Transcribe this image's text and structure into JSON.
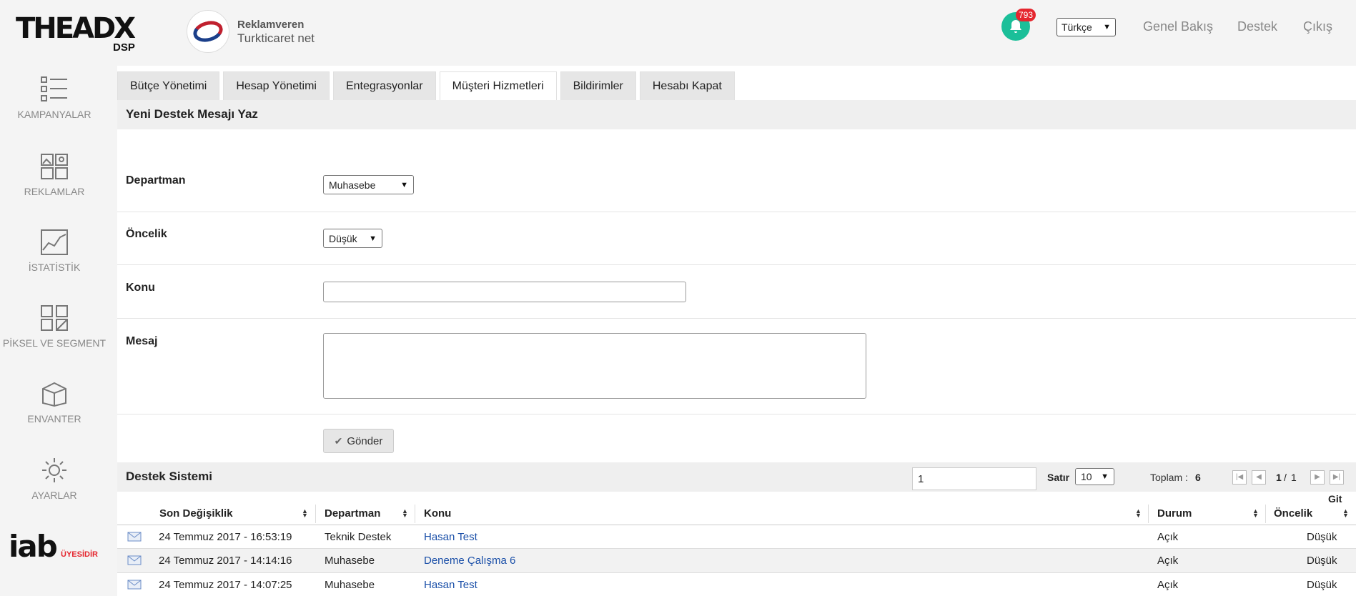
{
  "header": {
    "logo_text": "THEADX",
    "logo_sub": "DSP",
    "advertiser_label": "Reklamveren",
    "advertiser_name": "Turkticaret net",
    "notification_count": "793",
    "language": "Türkçe",
    "nav": [
      {
        "label": "Genel Bakış"
      },
      {
        "label": "Destek"
      },
      {
        "label": "Çıkış"
      }
    ],
    "brand_colors": {
      "notify": "#1bbf99",
      "badge": "#e5262e"
    }
  },
  "sidebar": {
    "items": [
      {
        "label": "KAMPANYALAR",
        "icon": "list-icon"
      },
      {
        "label": "REKLAMLAR",
        "icon": "images-icon"
      },
      {
        "label": "İSTATİSTİK",
        "icon": "chart-icon"
      },
      {
        "label": "PİKSEL VE SEGMENT",
        "icon": "grid-icon"
      },
      {
        "label": "ENVANTER",
        "icon": "box-icon"
      },
      {
        "label": "AYARLAR",
        "icon": "gear-icon"
      }
    ],
    "iab_text": "iab",
    "iab_sub": "ÜYESİDİR"
  },
  "tabs": [
    {
      "label": "Bütçe Yönetimi"
    },
    {
      "label": "Hesap Yönetimi"
    },
    {
      "label": "Entegrasyonlar"
    },
    {
      "label": "Müşteri Hizmetleri"
    },
    {
      "label": "Bildirimler"
    },
    {
      "label": "Hesabı Kapat"
    }
  ],
  "form": {
    "title": "Yeni Destek Mesajı Yaz",
    "department_label": "Departman",
    "department_value": "Muhasebe",
    "priority_label": "Öncelik",
    "priority_value": "Düşük",
    "subject_label": "Konu",
    "subject_value": "",
    "message_label": "Mesaj",
    "message_value": "",
    "send_label": "Gönder"
  },
  "support": {
    "title": "Destek Sistemi",
    "page_input": "1",
    "rows_label": "Satır",
    "rows_value": "10",
    "total_label": "Toplam :",
    "total_value": "6",
    "page_current": "1",
    "page_sep": "/",
    "page_total": "1",
    "go_label": "Git",
    "columns": [
      "Son Değişiklik",
      "Departman",
      "Konu",
      "Durum",
      "Öncelik"
    ],
    "rows": [
      {
        "date": "24 Temmuz 2017 - 16:53:19",
        "dept": "Teknik Destek",
        "subject": "Hasan Test",
        "status": "Açık",
        "priority": "Düşük"
      },
      {
        "date": "24 Temmuz 2017 - 14:14:16",
        "dept": "Muhasebe",
        "subject": "Deneme Çalışma 6",
        "status": "Açık",
        "priority": "Düşük"
      },
      {
        "date": "24 Temmuz 2017 - 14:07:25",
        "dept": "Muhasebe",
        "subject": "Hasan Test",
        "status": "Açık",
        "priority": "Düşük"
      }
    ]
  }
}
